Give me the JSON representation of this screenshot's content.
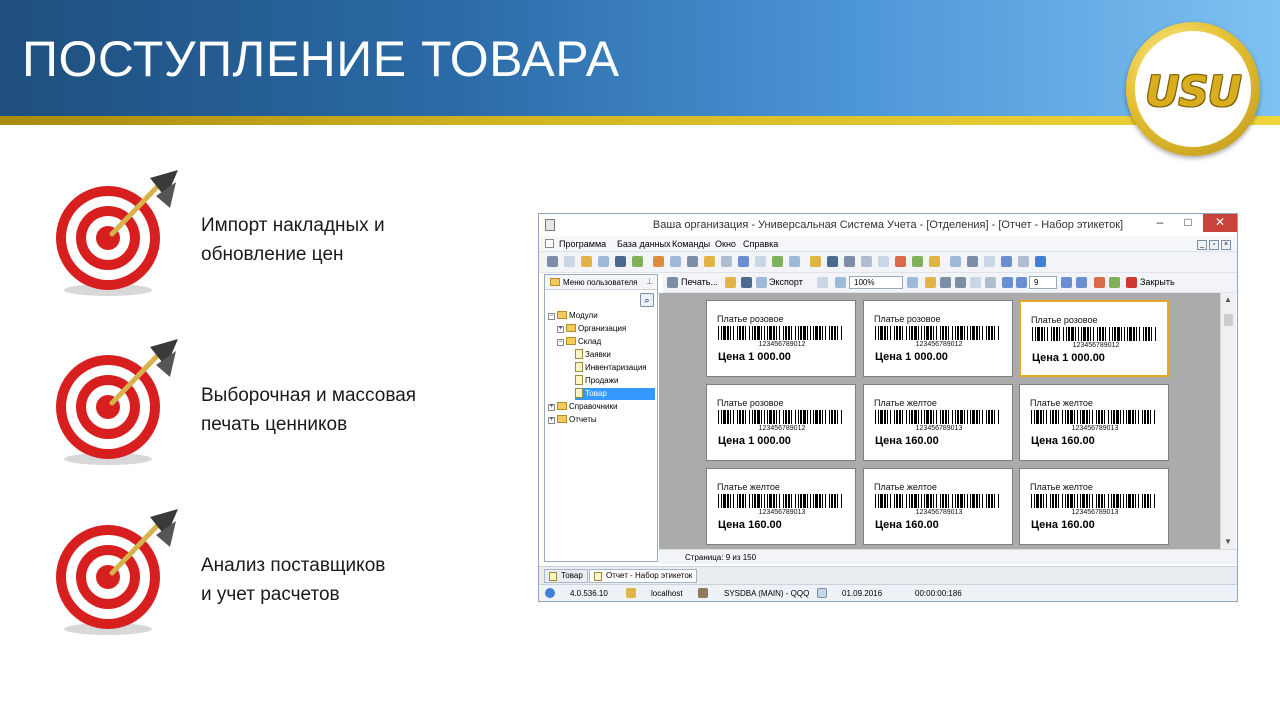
{
  "slide": {
    "title": "ПОСТУПЛЕНИЕ ТОВАРА",
    "logo_text": "USU",
    "features": [
      {
        "line1": "Импорт накладных и",
        "line2": "обновление цен",
        "icon": "target-icon"
      },
      {
        "line1": "Выборочная и массовая",
        "line2": "печать ценников",
        "icon": "target-icon"
      },
      {
        "line1": "Анализ поставщиков",
        "line2": "и учет расчетов",
        "icon": "target-icon"
      }
    ],
    "colors": {
      "header_dark": "#1f4f7e",
      "header_light": "#7ec2f3",
      "stripe": "#d2b422",
      "target_red": "#d81f1f"
    }
  },
  "app": {
    "title": "Ваша организация - Универсальная Система Учета - [Отделения] - [Отчет - Набор этикеток]",
    "window_buttons": {
      "minimize": "–",
      "maximize": "□",
      "close": "✕"
    },
    "menu": [
      "Программа",
      "База данных",
      "Команды",
      "Окно",
      "Справка"
    ],
    "nav": {
      "header": "Меню пользователя",
      "tree": [
        {
          "label": "Модули",
          "level": 0,
          "expanded": true
        },
        {
          "label": "Организация",
          "level": 1,
          "expanded": false
        },
        {
          "label": "Склад",
          "level": 1,
          "expanded": true
        },
        {
          "label": "Заявки",
          "level": 2
        },
        {
          "label": "Инвентаризация",
          "level": 2
        },
        {
          "label": "Продажи",
          "level": 2
        },
        {
          "label": "Товар",
          "level": 2,
          "selected": true
        },
        {
          "label": "Справочники",
          "level": 0,
          "expanded": false
        },
        {
          "label": "Отчеты",
          "level": 0,
          "expanded": false
        }
      ]
    },
    "report_toolbar": {
      "print": "Печать...",
      "export": "Экспорт",
      "zoom": "100%",
      "page_input": "9",
      "close": "Закрыть"
    },
    "labels": [
      {
        "name": "Платье розовое",
        "barcode": "123456789012",
        "price": "Цена 1 000.00",
        "selected": false
      },
      {
        "name": "Платье розовое",
        "barcode": "123456789012",
        "price": "Цена 1 000.00",
        "selected": false
      },
      {
        "name": "Платье розовое",
        "barcode": "123456789012",
        "price": "Цена 1 000.00",
        "selected": true
      },
      {
        "name": "Платье розовое",
        "barcode": "123456789012",
        "price": "Цена 1 000.00",
        "selected": false
      },
      {
        "name": "Платье желтое",
        "barcode": "123456789013",
        "price": "Цена 160.00",
        "selected": false
      },
      {
        "name": "Платье желтое",
        "barcode": "123456789013",
        "price": "Цена 160.00",
        "selected": false
      },
      {
        "name": "Платье желтое",
        "barcode": "123456789013",
        "price": "Цена 160.00",
        "selected": false
      },
      {
        "name": "Платье желтое",
        "barcode": "123456789013",
        "price": "Цена 160.00",
        "selected": false
      },
      {
        "name": "Платье желтое",
        "barcode": "123456789013",
        "price": "Цена 160.00",
        "selected": false
      }
    ],
    "page_status": "Страница: 9 из 150",
    "tabs": [
      {
        "label": "Товар",
        "active": false
      },
      {
        "label": "Отчет - Набор этикеток",
        "active": true
      }
    ],
    "status": {
      "version": "4.0.536.10",
      "server": "localhost",
      "user": "SYSDBA (MAIN) - QQQ",
      "date": "01.09.2016",
      "timer": "00:00:00:186"
    }
  }
}
